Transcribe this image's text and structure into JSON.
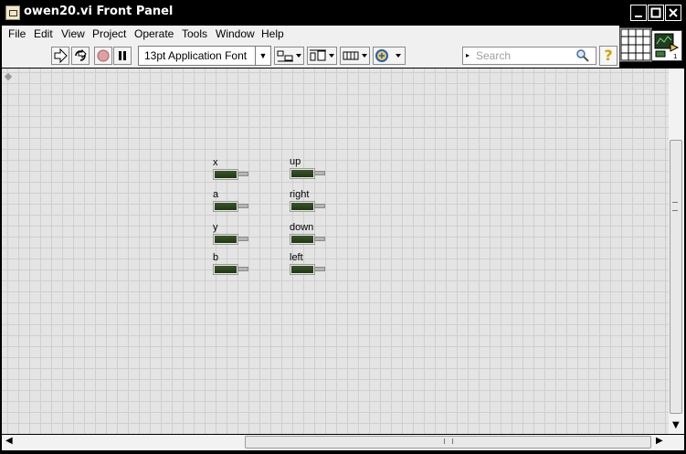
{
  "window": {
    "title": "owen20.vi Front Panel",
    "min_label": "_",
    "max_label": "□",
    "close_label": "✕"
  },
  "menu": [
    "File",
    "Edit",
    "View",
    "Project",
    "Operate",
    "Tools",
    "Window",
    "Help"
  ],
  "toolbar": {
    "font_label": "13pt Application Font",
    "search_placeholder": "Search",
    "help_label": "?"
  },
  "controls": [
    {
      "label": "x"
    },
    {
      "label": "a"
    },
    {
      "label": "y"
    },
    {
      "label": "b"
    },
    {
      "label": "up"
    },
    {
      "label": "right"
    },
    {
      "label": "down"
    },
    {
      "label": "left"
    }
  ],
  "icons": [
    "run-arrow-icon",
    "run-continuously-icon",
    "abort-icon",
    "pause-icon",
    "align-icon",
    "distribute-icon",
    "resize-icon",
    "reorder-icon",
    "search-icon",
    "help-icon",
    "connector-pane-icon",
    "vi-icon"
  ]
}
